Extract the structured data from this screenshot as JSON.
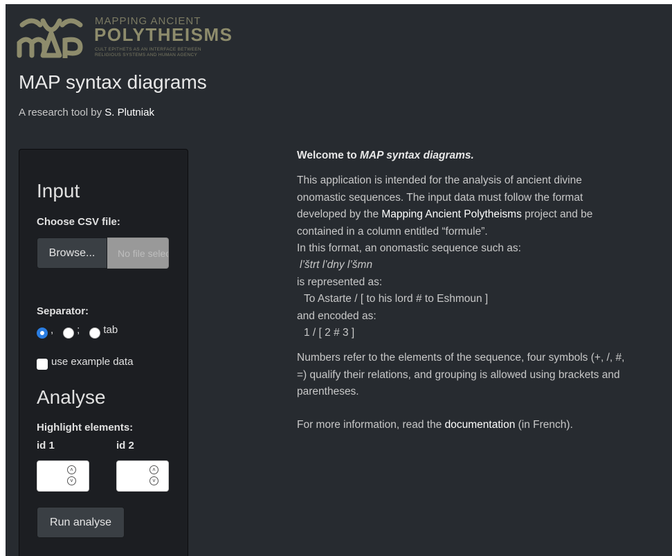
{
  "header": {
    "logo": {
      "mark_letters": "MAP",
      "line1": "MAPPING ANCIENT",
      "line2": "POLYTHEISMS",
      "line3": "CULT EPITHETS AS AN INTERFACE BETWEEN",
      "line4": "RELIGIOUS SYSTEMS AND HUMAN AGENCY"
    },
    "title": "MAP syntax diagrams",
    "byline_prefix": "A research tool by ",
    "byline_author": "S. Plutniak"
  },
  "sidebar": {
    "input_heading": "Input",
    "choose_label": "Choose CSV file:",
    "browse_label": "Browse...",
    "file_placeholder": "No file selected",
    "separator_label": "Separator:",
    "separator_options": [
      ",",
      ";",
      "tab"
    ],
    "separator_selected": ",",
    "example_label": "use example data",
    "example_checked": false,
    "analyse_heading": "Analyse",
    "highlight_label": "Highlight elements:",
    "id1_label": "id 1",
    "id2_label": "id 2",
    "id1_value": "",
    "id2_value": "",
    "run_label": "Run analyse"
  },
  "main": {
    "welcome_prefix": "Welcome to ",
    "welcome_app": "MAP syntax diagrams.",
    "para1_a": "This application is intended for the analysis of ancient divine onomastic sequences. The input data must follow the format developed by the ",
    "para1_link": "Mapping Ancient Polytheisms",
    "para1_b": " project and be contained in a column entitled “formule”.",
    "line_format": "In this format, an onomastic sequence such as:",
    "example_original": "l’štrt l’dny l’šmn",
    "line_represented": "is represented as:",
    "example_represented": "To Astarte / [ to his lord # to Eshmoun ]",
    "line_encoded": "and encoded as:",
    "example_encoded": "1 / [ 2 # 3 ]",
    "para2": "Numbers refer to the elements of the sequence, four symbols (+, /, #, =) qualify their relations, and grouping is allowed using brackets and parentheses.",
    "more_prefix": "For more information, read the ",
    "more_link": "documentation",
    "more_suffix": " (in French)."
  },
  "colors": {
    "background": "#272b30",
    "panel": "#1c1e22",
    "button": "#3a3f44",
    "accent": "#2a7de1",
    "logo": "#8e8c6c"
  }
}
